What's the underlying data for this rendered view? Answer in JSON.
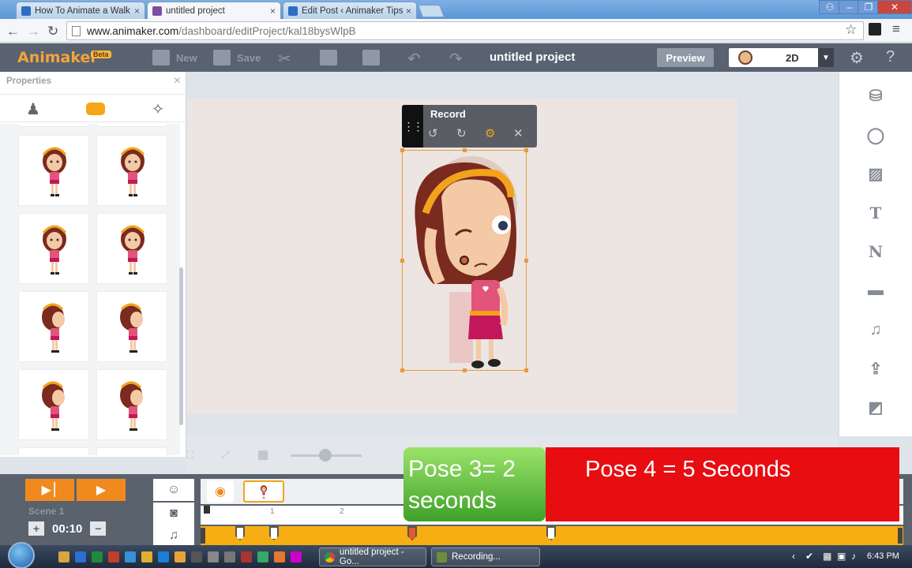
{
  "browser": {
    "tabs": [
      {
        "title": "How To Animate a Walk C",
        "active": false
      },
      {
        "title": "untitled project",
        "active": true
      },
      {
        "title": "Edit Post ‹ Animaker Tips",
        "active": false
      }
    ],
    "url_host": "www.animaker.com",
    "url_path": "/dashboard/editProject/kal18bysWlpB"
  },
  "app": {
    "logo": "Animaker",
    "badge": "Beta",
    "new_label": "New",
    "save_label": "Save",
    "project_title": "untitled project",
    "preview_label": "Preview",
    "dimension_value": "2D"
  },
  "properties": {
    "title": "Properties"
  },
  "record_panel": {
    "title": "Record"
  },
  "timeline": {
    "scene_label": "Scene 1",
    "duration": "00:10",
    "ruler_ticks": [
      "1",
      "2"
    ]
  },
  "captions": {
    "green": "Pose 3= 2 seconds",
    "red": "Pose 4 = 5 Seconds"
  },
  "taskbar": {
    "items": [
      "untitled project - Go...",
      "Recording..."
    ],
    "clock": "6:43 PM"
  },
  "colors": {
    "brand_orange": "#f4a43a",
    "header_bg": "#586270",
    "timeline_track": "#f7ae12",
    "caption_red": "#e80d11",
    "caption_green": "#4fb532"
  }
}
